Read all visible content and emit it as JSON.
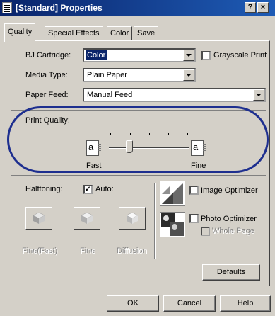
{
  "window": {
    "title": "[Standard] Properties",
    "help_label": "?",
    "close_label": "×"
  },
  "tabs": [
    {
      "label": "Quality",
      "active": true
    },
    {
      "label": "Special Effects",
      "active": false
    },
    {
      "label": "Color",
      "active": false
    },
    {
      "label": "Save",
      "active": false
    }
  ],
  "quality": {
    "bj_cartridge": {
      "label": "BJ Cartridge:",
      "value": "Color"
    },
    "grayscale_print": {
      "label": "Grayscale Print",
      "checked": false
    },
    "media_type": {
      "label": "Media Type:",
      "value": "Plain Paper"
    },
    "paper_feed": {
      "label": "Paper Feed:",
      "value": "Manual Feed"
    },
    "print_quality": {
      "label": "Print Quality:",
      "fast_label": "Fast",
      "fine_label": "Fine",
      "icon_glyph": "a",
      "level": 1,
      "levels": 5
    },
    "halftoning": {
      "label": "Halftoning:",
      "auto_label": "Auto:",
      "auto_checked": true,
      "auto_mark": "✓",
      "options": [
        "Fine(Fast)",
        "Fine",
        "Diffusion"
      ]
    },
    "image_optimizer": {
      "label": "Image Optimizer",
      "checked": false
    },
    "photo_optimizer": {
      "label": "Photo Optimizer",
      "checked": false
    },
    "whole_page": {
      "label": "Whole Page",
      "checked": false,
      "enabled": false
    },
    "defaults_label": "Defaults"
  },
  "footer": {
    "ok_label": "OK",
    "cancel_label": "Cancel",
    "help_label": "Help"
  },
  "colors": {
    "titlebar": "#0a246a",
    "face": "#d4d0c8",
    "annotation_ring": "#1e2f8f"
  }
}
